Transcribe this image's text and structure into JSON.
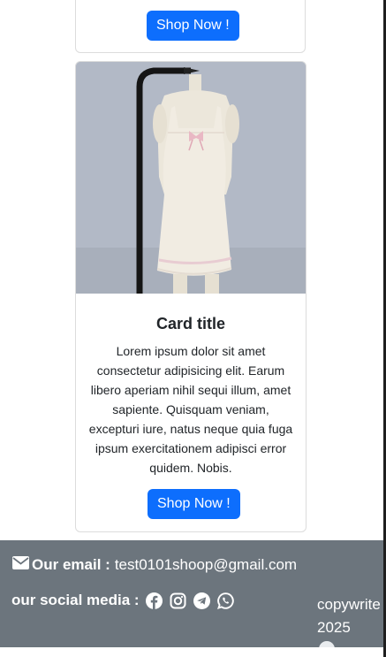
{
  "top_card": {
    "button_label": "Shop Now !"
  },
  "card": {
    "image_alt": "white slip dress on mannequin",
    "title": "Card title",
    "text": "Lorem ipsum dolor sit amet consectetur adipisicing elit. Earum libero aperiam nihil sequi illum, amet sapiente. Quisquam veniam, excepturi iure, natus neque quia fuga ipsum exercitationem adipisci error quidem. Nobis.",
    "button_label": "Shop Now !"
  },
  "footer": {
    "email_label": "Our email :",
    "email_value": "test0101shoop@gmail.com",
    "social_label": "our social media :",
    "social_icons": [
      "facebook-icon",
      "instagram-icon",
      "telegram-icon",
      "whatsapp-icon"
    ],
    "copyright": "copywrite 2025"
  },
  "colors": {
    "primary_button": "#0d6efd",
    "footer_bg": "#6c757d"
  }
}
